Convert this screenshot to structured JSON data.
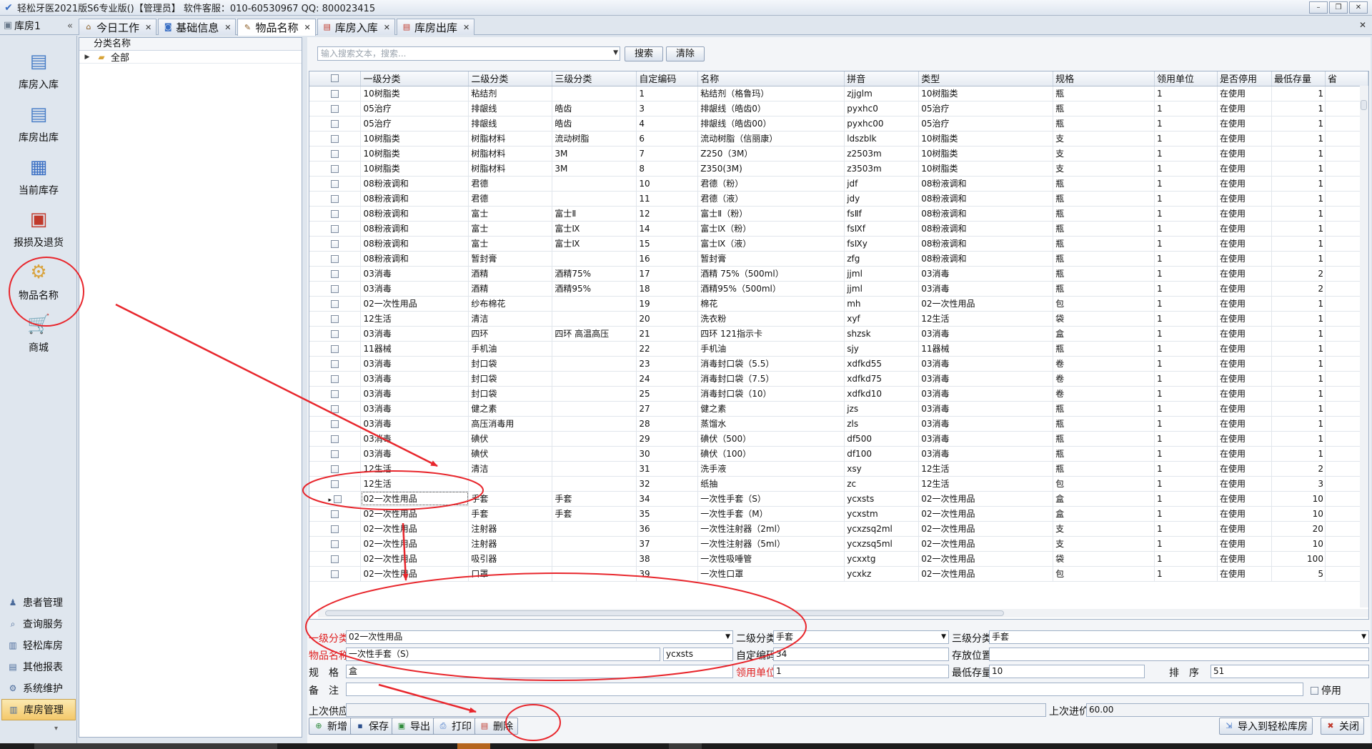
{
  "window": {
    "title": "轻松牙医2021版S6专业版()【管理员】   软件客服：010-60530967 QQ: 800023415",
    "controls": {
      "minimize": "–",
      "restore": "❐",
      "close": "✕"
    }
  },
  "sidebar": {
    "header": "库房1",
    "collapse_glyph": "«",
    "nav_buttons": [
      {
        "label": "库房入库",
        "icon": "stock-in-icon"
      },
      {
        "label": "库房出库",
        "icon": "stock-out-icon"
      },
      {
        "label": "当前库存",
        "icon": "inventory-grid-icon"
      },
      {
        "label": "报损及退货",
        "icon": "damage-return-icon"
      },
      {
        "label": "物品名称",
        "icon": "item-settings-icon"
      },
      {
        "label": "商城",
        "icon": "cart-icon"
      }
    ],
    "groups": [
      {
        "label": "患者管理",
        "icon": "users-icon"
      },
      {
        "label": "查询服务",
        "icon": "search-icon"
      },
      {
        "label": "轻松库房",
        "icon": "warehouse-icon"
      },
      {
        "label": "其他报表",
        "icon": "report-icon"
      },
      {
        "label": "系统维护",
        "icon": "gear-icon"
      },
      {
        "label": "库房管理",
        "icon": "warehouse-manage-icon",
        "active": true
      }
    ]
  },
  "tabs": [
    {
      "label": "今日工作",
      "icon": "home-icon"
    },
    {
      "label": "基础信息",
      "icon": "info-icon"
    },
    {
      "label": "物品名称",
      "icon": "item-icon",
      "active": true
    },
    {
      "label": "库房入库",
      "icon": "doc-in-icon"
    },
    {
      "label": "库房出库",
      "icon": "doc-out-icon"
    }
  ],
  "tree": {
    "header": "分类名称",
    "root": "全部"
  },
  "search": {
    "placeholder": "输入搜索文本，搜索...",
    "search_label": "搜索",
    "clear_label": "清除"
  },
  "table": {
    "columns": [
      "",
      "一级分类",
      "二级分类",
      "三级分类",
      "自定编码",
      "名称",
      "拼音",
      "类型",
      "规格",
      "领用单位",
      "是否停用",
      "最低存量",
      "省"
    ],
    "rows": [
      [
        "10树脂类",
        "粘结剂",
        "",
        "1",
        "粘结剂（格鲁玛）",
        "zjjglm",
        "10树脂类",
        "瓶",
        "1",
        "在使用",
        "1"
      ],
      [
        "05治疗",
        "排龈线",
        "皓齿",
        "3",
        "排龈线（皓齿0）",
        "pyxhc0",
        "05治疗",
        "瓶",
        "1",
        "在使用",
        "1"
      ],
      [
        "05治疗",
        "排龈线",
        "皓齿",
        "4",
        "排龈线（皓齿00）",
        "pyxhc00",
        "05治疗",
        "瓶",
        "1",
        "在使用",
        "1"
      ],
      [
        "10树脂类",
        "树脂材料",
        "流动树脂",
        "6",
        "流动树脂（信丽康）",
        "ldszblk",
        "10树脂类",
        "支",
        "1",
        "在使用",
        "1"
      ],
      [
        "10树脂类",
        "树脂材料",
        "3M",
        "7",
        "Z250（3M）",
        "z2503m",
        "10树脂类",
        "支",
        "1",
        "在使用",
        "1"
      ],
      [
        "10树脂类",
        "树脂材料",
        "3M",
        "8",
        "Z350(3M)",
        "z3503m",
        "10树脂类",
        "支",
        "1",
        "在使用",
        "1"
      ],
      [
        "08粉液调和",
        "君德",
        "",
        "10",
        "君德（粉）",
        "jdf",
        "08粉液调和",
        "瓶",
        "1",
        "在使用",
        "1"
      ],
      [
        "08粉液调和",
        "君德",
        "",
        "11",
        "君德（液）",
        "jdy",
        "08粉液调和",
        "瓶",
        "1",
        "在使用",
        "1"
      ],
      [
        "08粉液调和",
        "富士",
        "富士Ⅱ",
        "12",
        "富士Ⅱ（粉）",
        "fsⅡf",
        "08粉液调和",
        "瓶",
        "1",
        "在使用",
        "1"
      ],
      [
        "08粉液调和",
        "富士",
        "富士Ⅸ",
        "14",
        "富士Ⅸ（粉）",
        "fsⅨf",
        "08粉液调和",
        "瓶",
        "1",
        "在使用",
        "1"
      ],
      [
        "08粉液调和",
        "富士",
        "富士Ⅸ",
        "15",
        "富士Ⅸ（液）",
        "fsⅨy",
        "08粉液调和",
        "瓶",
        "1",
        "在使用",
        "1"
      ],
      [
        "08粉液调和",
        "暂封膏",
        "",
        "16",
        "暂封膏",
        "zfg",
        "08粉液调和",
        "瓶",
        "1",
        "在使用",
        "1"
      ],
      [
        "03消毒",
        "酒精",
        "酒精75%",
        "17",
        "酒精 75%（500ml）",
        "jjml",
        "03消毒",
        "瓶",
        "1",
        "在使用",
        "2"
      ],
      [
        "03消毒",
        "酒精",
        "酒精95%",
        "18",
        "酒精95%（500ml）",
        "jjml",
        "03消毒",
        "瓶",
        "1",
        "在使用",
        "2"
      ],
      [
        "02一次性用品",
        "纱布棉花",
        "",
        "19",
        "棉花",
        "mh",
        "02一次性用品",
        "包",
        "1",
        "在使用",
        "1"
      ],
      [
        "12生活",
        "清洁",
        "",
        "20",
        "洗衣粉",
        "xyf",
        "12生活",
        "袋",
        "1",
        "在使用",
        "1"
      ],
      [
        "03消毒",
        "四环",
        "四环 高温高压",
        "21",
        "四环 121指示卡",
        "shzsk",
        "03消毒",
        "盒",
        "1",
        "在使用",
        "1"
      ],
      [
        "11器械",
        "手机油",
        "",
        "22",
        "手机油",
        "sjy",
        "11器械",
        "瓶",
        "1",
        "在使用",
        "1"
      ],
      [
        "03消毒",
        "封口袋",
        "",
        "23",
        "消毒封口袋（5.5）",
        "xdfkd55",
        "03消毒",
        "卷",
        "1",
        "在使用",
        "1"
      ],
      [
        "03消毒",
        "封口袋",
        "",
        "24",
        "消毒封口袋（7.5）",
        "xdfkd75",
        "03消毒",
        "卷",
        "1",
        "在使用",
        "1"
      ],
      [
        "03消毒",
        "封口袋",
        "",
        "25",
        "消毒封口袋（10）",
        "xdfkd10",
        "03消毒",
        "卷",
        "1",
        "在使用",
        "1"
      ],
      [
        "03消毒",
        "健之素",
        "",
        "27",
        "健之素",
        "jzs",
        "03消毒",
        "瓶",
        "1",
        "在使用",
        "1"
      ],
      [
        "03消毒",
        "高压消毒用",
        "",
        "28",
        "蒸馏水",
        "zls",
        "03消毒",
        "瓶",
        "1",
        "在使用",
        "1"
      ],
      [
        "03消毒",
        "碘伏",
        "",
        "29",
        "碘伏（500）",
        "df500",
        "03消毒",
        "瓶",
        "1",
        "在使用",
        "1"
      ],
      [
        "03消毒",
        "碘伏",
        "",
        "30",
        "碘伏（100）",
        "df100",
        "03消毒",
        "瓶",
        "1",
        "在使用",
        "1"
      ],
      [
        "12生活",
        "清洁",
        "",
        "31",
        "洗手液",
        "xsy",
        "12生活",
        "瓶",
        "1",
        "在使用",
        "2"
      ],
      [
        "12生活",
        "",
        "",
        "32",
        "纸抽",
        "zc",
        "12生活",
        "包",
        "1",
        "在使用",
        "3"
      ],
      [
        "02一次性用品",
        "手套",
        "手套",
        "34",
        "一次性手套（S）",
        "ycxsts",
        "02一次性用品",
        "盒",
        "1",
        "在使用",
        "10"
      ],
      [
        "02一次性用品",
        "手套",
        "手套",
        "35",
        "一次性手套（M）",
        "ycxstm",
        "02一次性用品",
        "盒",
        "1",
        "在使用",
        "10"
      ],
      [
        "02一次性用品",
        "注射器",
        "",
        "36",
        "一次性注射器（2ml）",
        "ycxzsq2ml",
        "02一次性用品",
        "支",
        "1",
        "在使用",
        "20"
      ],
      [
        "02一次性用品",
        "注射器",
        "",
        "37",
        "一次性注射器（5ml）",
        "ycxzsq5ml",
        "02一次性用品",
        "支",
        "1",
        "在使用",
        "10"
      ],
      [
        "02一次性用品",
        "吸引器",
        "",
        "38",
        "一次性吸唾管",
        "ycxxtg",
        "02一次性用品",
        "袋",
        "1",
        "在使用",
        "100"
      ],
      [
        "02一次性用品",
        "口罩",
        "",
        "39",
        "一次性口罩",
        "ycxkz",
        "02一次性用品",
        "包",
        "1",
        "在使用",
        "5"
      ]
    ]
  },
  "form": {
    "level1_label": "一级分类",
    "level1_value": "02一次性用品",
    "level2_label": "二级分类",
    "level2_value": "手套",
    "level3_label": "三级分类",
    "level3_value": "手套",
    "name_label": "物品名称",
    "name_value": "一次性手套（S）",
    "pinyin_value": "ycxsts",
    "code_label": "自定编码",
    "code_value": "34",
    "location_label": "存放位置",
    "location_value": "",
    "spec_label": "规　格",
    "spec_value": "盒",
    "unit_label": "领用单位",
    "unit_value": "1",
    "minstock_label": "最低存量",
    "minstock_value": "10",
    "order_label": "排　序",
    "order_value": "51",
    "remark_label": "备　注",
    "remark_value": "",
    "disabled_label": "停用",
    "supplier_label": "上次供应",
    "supplier_value": "",
    "lastprice_label": "上次进价",
    "lastprice_value": "60.00"
  },
  "buttons": {
    "new": "新增",
    "save": "保存",
    "export": "导出",
    "print": "打印",
    "delete": "删除",
    "import": "导入到轻松库房",
    "close": "关闭"
  },
  "colors": {
    "required_label": "#e02020",
    "annotation": "#e8262c",
    "active_group": "#f4c86a"
  }
}
